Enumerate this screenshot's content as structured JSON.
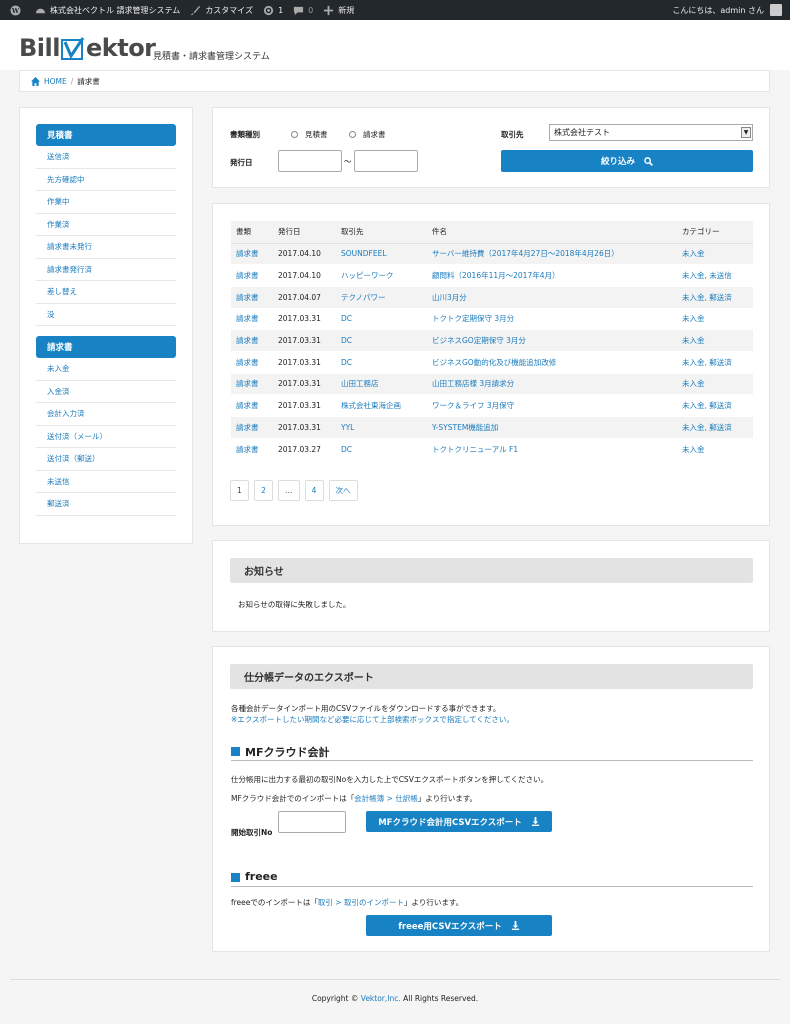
{
  "adminbar": {
    "site_name": "株式会社ベクトル 請求管理システム",
    "customize": "カスタマイズ",
    "updates_count": "1",
    "comments_count": "0",
    "new_label": "新規",
    "greeting": "こんにちは、admin さん"
  },
  "header": {
    "logo_left": "Bill",
    "logo_right": "ektor",
    "tagline": "見積書・請求書管理システム"
  },
  "breadcrumb": {
    "home": "HOME",
    "separator": "/",
    "current": "請求書"
  },
  "sidebar": {
    "sections": [
      {
        "title": "見積書",
        "items": [
          "送信済",
          "先方確認中",
          "作業中",
          "作業済",
          "請求書未発行",
          "請求書発行済",
          "差し替え",
          "没"
        ]
      },
      {
        "title": "請求書",
        "items": [
          "未入金",
          "入金済",
          "会計入力済",
          "送付済（メール）",
          "送付済（郵送）",
          "未送信",
          "郵送済"
        ]
      }
    ]
  },
  "search": {
    "doc_type_label": "書類種別",
    "option_estimate": "見積書",
    "option_invoice": "請求書",
    "issue_date_label": "発行日",
    "range_sep": "〜",
    "client_label": "取引先",
    "client_value": "株式会社テスト",
    "filter_button": "絞り込み"
  },
  "table": {
    "headers": [
      "書類",
      "発行日",
      "取引先",
      "件名",
      "カテゴリー"
    ],
    "rows": [
      [
        "請求書",
        "2017.04.10",
        "SOUNDFEEL",
        "サーバー維持費（2017年4月27日〜2018年4月26日）",
        "未入金"
      ],
      [
        "請求書",
        "2017.04.10",
        "ハッピーワーク",
        "顧問料（2016年11月〜2017年4月）",
        "未入金, 未送信"
      ],
      [
        "請求書",
        "2017.04.07",
        "テクノパワー",
        "山川3月分",
        "未入金, 郵送済"
      ],
      [
        "請求書",
        "2017.03.31",
        "DC",
        "トクトク定期保守 3月分",
        "未入金"
      ],
      [
        "請求書",
        "2017.03.31",
        "DC",
        "ビジネスGO定期保守 3月分",
        "未入金"
      ],
      [
        "請求書",
        "2017.03.31",
        "DC",
        "ビジネスGO動的化及び機能追加改修",
        "未入金, 郵送済"
      ],
      [
        "請求書",
        "2017.03.31",
        "山田工務店",
        "山田工務店様 3月請求分",
        "未入金"
      ],
      [
        "請求書",
        "2017.03.31",
        "株式会社東海企画",
        "ワーク＆ライフ 3月保守",
        "未入金, 郵送済"
      ],
      [
        "請求書",
        "2017.03.31",
        "YYL",
        "Y-SYSTEM機能追加",
        "未入金, 郵送済"
      ],
      [
        "請求書",
        "2017.03.27",
        "DC",
        "トクトクリニューアル F1",
        "未入金"
      ]
    ]
  },
  "pager": {
    "pages": [
      "1",
      "2",
      "…",
      "4"
    ],
    "next": "次へ"
  },
  "notice": {
    "title": "お知らせ",
    "message": "お知らせの取得に失敗しました。"
  },
  "export": {
    "title": "仕分帳データのエクスポート",
    "desc1": "各種会計データインポート用のCSVファイルをダウンロードする事ができます。",
    "desc2": "※エクスポートしたい期間など必要に応じて上部検索ボックスで指定してください。",
    "mf": {
      "heading": "MFクラウド会計",
      "instruction": "仕分帳用に出力する最初の取引Noを入力した上でCSVエクスポートボタンを押してください。",
      "import_prefix": "MFクラウド会計でのインポートは「",
      "import_link": "会計帳簿 > 仕訳帳",
      "import_suffix": "」より行います。",
      "start_no_label": "開始取引No",
      "button": "MFクラウド会計用CSVエクスポート"
    },
    "freee": {
      "heading": "freee",
      "import_prefix": "freeeでのインポートは「",
      "import_link": "取引 > 取引のインポート",
      "import_suffix": "」より行います。",
      "button": "freee用CSVエクスポート"
    }
  },
  "footer": {
    "prefix": "Copyright © ",
    "link": "Vektor,Inc.",
    "suffix": " All Rights Reserved."
  },
  "colors": {
    "accent": "#1783c4",
    "link": "#1a7bbd",
    "adminbar": "#23282d"
  }
}
